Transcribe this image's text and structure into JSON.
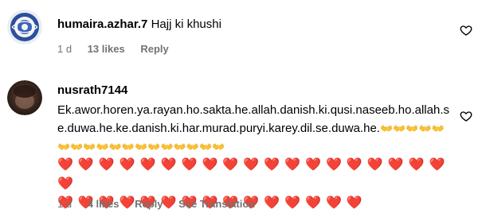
{
  "comments": [
    {
      "username": "humaira.azhar.7",
      "text": "Hajj ki khushi",
      "time": "1 d",
      "likes": "13 likes",
      "reply_label": "Reply",
      "see_translation": ""
    },
    {
      "username": "nusrath7144",
      "text": "Ek.awor.horen.ya.rayan.ho.sakta.he.allah.danish.ki.qusi.naseeb.ho.allah.se.duwa.he.ke.danish.ki.har.murad.puryi.karey.dil.se.duwa.he.",
      "emoji_hands": "👐👐👐👐👐👐👐👐👐👐👐👐👐👐👐👐👐👐",
      "emoji_hearts_1": "❤️❤️❤️❤️❤️❤️❤️❤️❤️❤️❤️❤️❤️❤️❤️❤️❤️❤️❤️❤️",
      "emoji_hearts_2": "❤️❤️❤️❤️❤️❤️❤️❤️❤️❤️❤️❤️❤️❤️❤️",
      "time": "1 d",
      "likes": "4 likes",
      "reply_label": "Reply",
      "see_translation": "See Translation"
    }
  ],
  "icons": {
    "like": "heart-outline-icon"
  },
  "colors": {
    "meta": "#737373",
    "heart": "#e0233a"
  }
}
